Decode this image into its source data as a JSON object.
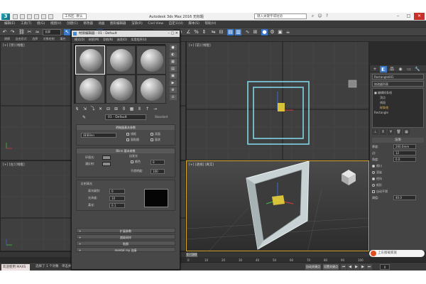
{
  "app": {
    "window_title": "Autodesk 3ds Max 2016    无标题",
    "workspace": "工作区: 默认",
    "search_placeholder": "键入关键字或短语",
    "logo": "3"
  },
  "menubar": [
    "编辑(E)",
    "工具(T)",
    "组(G)",
    "视图(V)",
    "创建(C)",
    "修改器",
    "动画",
    "图形编辑器",
    "渲染(R)",
    "Civil View",
    "自定义(U)",
    "脚本(S)",
    "帮助(H)"
  ],
  "toolbar": {
    "selection_filter": "全部",
    "view_dropdown": "视图",
    "named_set": "创建选择集"
  },
  "ribbon_row": [
    "建模",
    "自由形式",
    "选择",
    "对象绘制",
    "填充"
  ],
  "viewports": {
    "top_left_label": "[+] [顶] [线框]",
    "top_right_label": "[+] [前] [线框]",
    "bottom_left_label": "[+] [左] [线框]",
    "perspective_label": "[+] [透视] [真实]"
  },
  "material_editor": {
    "title": "材质编辑器 - 01 - Default",
    "menu": [
      "模式(D)",
      "材质(M)",
      "导航(N)",
      "选项(O)",
      "实用程序(U)"
    ],
    "slots_count": 6,
    "material_name": "01 - Default",
    "material_type": "Standard",
    "shader_rollout": "明暗器基本参数",
    "shader": "(B)Blinn",
    "shader_opts": [
      "线框",
      "双面",
      "面贴图",
      "面状"
    ],
    "basic_rollout": "Blinn 基本参数",
    "ambient_label": "环境光:",
    "diffuse_label": "漫反射:",
    "self_illum_group": "自发光",
    "color_label": "颜色",
    "color_value": "0",
    "opacity_label": "不透明度:",
    "opacity_value": "100",
    "specular_group": "反射高光",
    "spec_level_label": "高光级别:",
    "spec_level_value": "0",
    "gloss_label": "光泽度:",
    "gloss_value": "10",
    "soften_label": "柔化:",
    "soften_value": "0.1",
    "collapsed_rollouts": [
      "扩展参数",
      "超级采样",
      "贴图",
      "mental ray 连接"
    ]
  },
  "command_panel": {
    "tabs": [
      "+",
      "◧",
      "品",
      "◉",
      "▭",
      "🔧"
    ],
    "object_name": "Rectangle001",
    "modifier_list": "修改器列表",
    "stack": [
      {
        "label": "■ 编辑样条线",
        "sub": false,
        "sel": false
      },
      {
        "label": "顶点",
        "sub": true,
        "sel": false
      },
      {
        "label": "线段",
        "sub": true,
        "sel": false
      },
      {
        "label": "样条线",
        "sub": true,
        "sel": true
      },
      {
        "label": "Rectangle",
        "sub": false,
        "sel": false
      }
    ],
    "rollout_render": "渲染",
    "thickness_label": "厚度:",
    "thickness_value": "200.0mm",
    "sides_label": "边:",
    "sides_value": "12",
    "angle_label": "角度:",
    "angle_value": "0.0",
    "opt_viewport": "视口",
    "opt_renderer": "渲染",
    "opt_radial": "径向",
    "opt_rect": "矩形",
    "auto_smooth": "自动平滑",
    "threshold_label": "阈值:",
    "threshold_value": "40.0"
  },
  "timeline": {
    "slider": "0 / 100",
    "ticks": [
      "0",
      "10",
      "20",
      "30",
      "40",
      "50",
      "60",
      "70",
      "80",
      "90",
      "100"
    ]
  },
  "statusbar": {
    "maxscript": "欢迎使用 MAXS",
    "status": "选择了 1 个对象",
    "prompt": "单击并拖动以选择并移动对象",
    "autokey": "自动关键点",
    "setkey": "设置关键点",
    "frame": "0",
    "grid": "栅格 = 100.0mm"
  },
  "watermark": "上东版载家族"
}
